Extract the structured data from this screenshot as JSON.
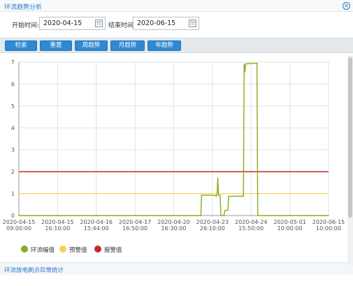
{
  "window": {
    "title": "环流趋势分析"
  },
  "filter": {
    "start_label": "开始时间:",
    "start_value": "2020-04-15",
    "end_label": "结束时间",
    "end_value": "2020-06-15"
  },
  "toolbar": {
    "buttons": [
      {
        "label": "检索"
      },
      {
        "label": "重置"
      },
      {
        "label": "周趋势"
      },
      {
        "label": "月趋势"
      },
      {
        "label": "年趋势"
      }
    ]
  },
  "chart_data": {
    "type": "line",
    "ylim": [
      0,
      7
    ],
    "y_ticks": [
      "0",
      "1",
      "2",
      "3",
      "4",
      "5",
      "6",
      "7"
    ],
    "x_ticks": [
      [
        "2020-04-15",
        "09:00:00"
      ],
      [
        "2020-04-15",
        "16:10:00"
      ],
      [
        "2020-04-16",
        "15:44:00"
      ],
      [
        "2020-04-17",
        "16:50:00"
      ],
      [
        "2020-04-20",
        "16:30:00"
      ],
      [
        "2020-04-23",
        "26:10:00"
      ],
      [
        "2020-04-24",
        "15:50:00"
      ],
      [
        "2020-05-01",
        "10:00:00"
      ],
      [
        "2020-06-15",
        "10:00:00"
      ]
    ],
    "thresholds": [
      {
        "name": "预警值",
        "value": 1,
        "color": "#f7d255"
      },
      {
        "name": "报警值",
        "value": 2,
        "color": "#c62828"
      }
    ],
    "series": [
      {
        "name": "环流幅值",
        "color": "#86ad1e",
        "points": [
          [
            0,
            0
          ],
          [
            4.7,
            0
          ],
          [
            4.72,
            0.93
          ],
          [
            5.05,
            0.93
          ],
          [
            5.1,
            0.88
          ],
          [
            5.12,
            0.96
          ],
          [
            5.14,
            1.7
          ],
          [
            5.16,
            0.93
          ],
          [
            5.2,
            0.93
          ],
          [
            5.22,
            0.0
          ],
          [
            5.3,
            0.0
          ],
          [
            5.32,
            0.22
          ],
          [
            5.4,
            0.25
          ],
          [
            5.42,
            0.88
          ],
          [
            5.8,
            0.88
          ],
          [
            5.82,
            6.9
          ],
          [
            5.84,
            6.55
          ],
          [
            5.86,
            6.92
          ],
          [
            6.15,
            6.95
          ],
          [
            6.17,
            0.0
          ],
          [
            7.5,
            0.0
          ],
          [
            8,
            0.0
          ]
        ]
      }
    ],
    "legend": [
      {
        "name": "环流幅值",
        "color": "#86ad1e"
      },
      {
        "name": "预警值",
        "color": "#f7d255"
      },
      {
        "name": "报警值",
        "color": "#c62828"
      }
    ]
  },
  "footer": {
    "title": "环流放电刷点异常统计"
  }
}
